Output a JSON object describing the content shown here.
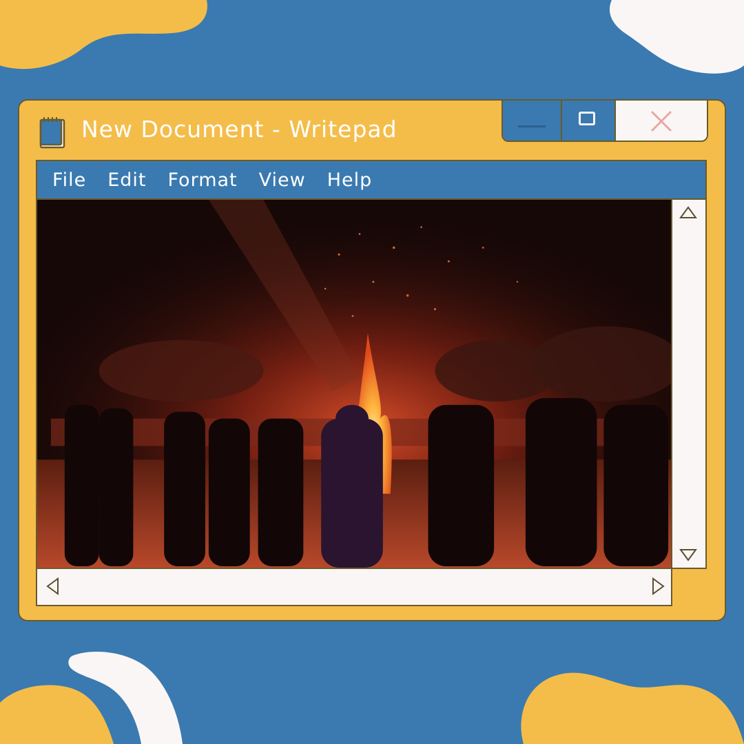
{
  "window": {
    "title": "New Document - Writepad",
    "doc_icon": "notepad-icon",
    "controls": {
      "minimize_icon": "minimize-icon",
      "maximize_icon": "maximize-icon",
      "close_icon": "close-icon"
    }
  },
  "menu": {
    "items": [
      "File",
      "Edit",
      "Format",
      "View",
      "Help"
    ]
  },
  "content": {
    "image": "night-campfire-scouts-photo"
  },
  "scrollbars": {
    "vertical": {
      "up_icon": "scroll-up-arrow-icon",
      "down_icon": "scroll-down-arrow-icon"
    },
    "horizontal": {
      "left_icon": "scroll-left-arrow-icon",
      "right_icon": "scroll-right-arrow-icon"
    }
  },
  "colors": {
    "background": "#3a7ab0",
    "window_frame": "#f4bd4a",
    "menu_bar": "#3a7ab0",
    "scrollbar": "#fbf6f6",
    "close_x": "#e8a6a0",
    "blob_yellow": "#f4bd4a",
    "blob_white": "#fbf6f6"
  }
}
